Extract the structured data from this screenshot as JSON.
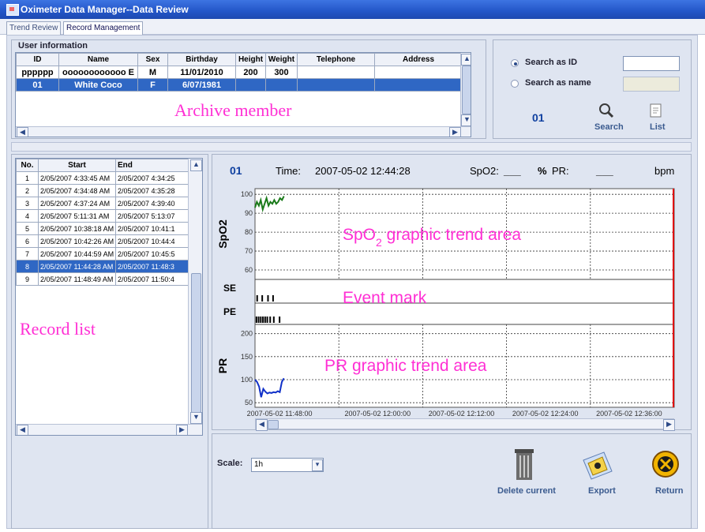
{
  "window": {
    "title": "Oximeter Data Manager--Data Review"
  },
  "tabs": [
    {
      "label": "Trend Review"
    },
    {
      "label": "Record Management"
    }
  ],
  "user_info": {
    "header": "User information",
    "columns": [
      "ID",
      "Name",
      "Sex",
      "Birthday",
      "Height",
      "Weight",
      "Telephone",
      "Address"
    ],
    "rows": [
      {
        "id": "pppppp",
        "name": "oooooooooooo E",
        "sex": "M",
        "birthday": "11/01/2010",
        "height": "200",
        "weight": "300",
        "telephone": "",
        "address": ""
      },
      {
        "id": "01",
        "name": "White Coco",
        "sex": "F",
        "birthday": "6/07/1981",
        "height": "",
        "weight": "",
        "telephone": "",
        "address": ""
      }
    ],
    "selected_row": 1,
    "overlay_label": "Archive member"
  },
  "search": {
    "option_id": "Search as ID",
    "option_name": "Search as name",
    "selected": "id",
    "id_value": "",
    "name_value": "",
    "current_id": "01",
    "search_label": "Search",
    "list_label": "List"
  },
  "record_list": {
    "columns": [
      "No.",
      "Start",
      "End"
    ],
    "rows": [
      {
        "no": "1",
        "start": "2/05/2007 4:33:45 AM",
        "end": "2/05/2007 4:34:25"
      },
      {
        "no": "2",
        "start": "2/05/2007 4:34:48 AM",
        "end": "2/05/2007 4:35:28"
      },
      {
        "no": "3",
        "start": "2/05/2007 4:37:24 AM",
        "end": "2/05/2007 4:39:40"
      },
      {
        "no": "4",
        "start": "2/05/2007 5:11:31 AM",
        "end": "2/05/2007 5:13:07"
      },
      {
        "no": "5",
        "start": "2/05/2007 10:38:18 AM",
        "end": "2/05/2007 10:41:1"
      },
      {
        "no": "6",
        "start": "2/05/2007 10:42:26 AM",
        "end": "2/05/2007 10:44:4"
      },
      {
        "no": "7",
        "start": "2/05/2007 10:44:59 AM",
        "end": "2/05/2007 10:45:5"
      },
      {
        "no": "8",
        "start": "2/05/2007 11:44:28 AM",
        "end": "2/05/2007 11:48:3"
      },
      {
        "no": "9",
        "start": "2/05/2007 11:48:49 AM",
        "end": "2/05/2007 11:50:4"
      }
    ],
    "selected_row": 7,
    "overlay_label": "Record list"
  },
  "chart_header": {
    "id": "01",
    "time_label": "Time:",
    "time_value": "2007-05-02  12:44:28",
    "spo2_label": "SpO2:",
    "spo2_value": "___",
    "spo2_unit": "%",
    "pr_label": "PR:",
    "pr_value": "___",
    "pr_unit": "bpm"
  },
  "overlays": {
    "spo2_area_main": "SpO",
    "spo2_area_sub": "2",
    "spo2_area_rest": " graphic trend area",
    "event_mark": "Event mark",
    "pr_area": "PR graphic trend area"
  },
  "colors": {
    "spo2_line": "#1a7a1a",
    "pr_line": "#1030c8",
    "cursor": "#e01010",
    "overlay_text": "#ff2fd4",
    "selection": "#2f67c4"
  },
  "chart_data": {
    "type": "line",
    "x_tick_labels": [
      "2007-05-02  11:48:00",
      "2007-05-02  12:00:00",
      "2007-05-02  12:12:00",
      "2007-05-02  12:24:00",
      "2007-05-02  12:36:00"
    ],
    "panels": [
      {
        "name": "SpO2",
        "ylabel": "SpO2",
        "ylim": [
          55,
          103
        ],
        "yticks": [
          60,
          70,
          80,
          90,
          100
        ],
        "series": [
          {
            "values": [
              93,
              96,
              94,
              97,
              92,
              95,
              98,
              94,
              96,
              95,
              97,
              95,
              96,
              98,
              97,
              99
            ]
          }
        ]
      },
      {
        "name": "SE",
        "ylabel": "SE",
        "marks": [
          0.3,
          1.0,
          1.8,
          2.5
        ]
      },
      {
        "name": "PE",
        "ylabel": "PE",
        "marks": [
          0.2,
          0.5,
          0.8,
          1.1,
          1.4,
          1.7,
          2.1,
          2.6,
          3.4
        ]
      },
      {
        "name": "PR",
        "ylabel": "PR",
        "ylim": [
          40,
          220
        ],
        "yticks": [
          50,
          100,
          150,
          200
        ],
        "series": [
          {
            "values": [
              100,
              95,
              85,
              62,
              80,
              74,
              70,
              72,
              71,
              73,
              72,
              75,
              73,
              95,
              103
            ]
          }
        ]
      }
    ],
    "x_range_minutes": [
      0,
      58
    ],
    "series_span_minutes": 4,
    "grid": true
  },
  "scale": {
    "label": "Scale:",
    "value": "1h"
  },
  "actions": {
    "delete": "Delete current",
    "export": "Export",
    "return": "Return"
  }
}
